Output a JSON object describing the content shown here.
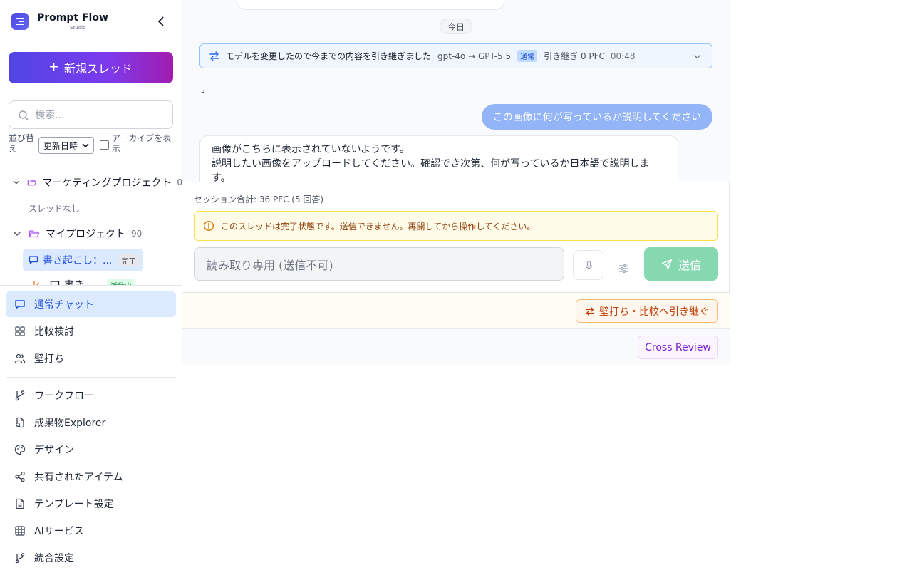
{
  "brand": {
    "title": "Prompt Flow",
    "subtitle": "Studio"
  },
  "sidebar": {
    "new_thread_label": "新規スレッド",
    "search_placeholder": "検索...",
    "sort_label": "並び替え",
    "sort_value": "更新日時",
    "archive_label": "アーカイブを表示",
    "projects": [
      {
        "name": "マーケティングプロジェクト",
        "count": "0",
        "empty_text": "スレッドなし"
      },
      {
        "name": "マイプロジェクト",
        "count": "90"
      }
    ],
    "threads": [
      {
        "title": "書き起こし：...",
        "badge": "完了"
      },
      {
        "title": "書き",
        "badge": "活動中"
      }
    ],
    "nav": [
      {
        "label": "通常チャット",
        "icon": "chat-bubble-icon"
      },
      {
        "label": "比較検討",
        "icon": "grid-icon"
      },
      {
        "label": "壁打ち",
        "icon": "users-icon"
      },
      {
        "label": "ワークフロー",
        "icon": "git-branch-icon"
      },
      {
        "label": "成果物Explorer",
        "icon": "file-search-icon"
      },
      {
        "label": "デザイン",
        "icon": "palette-icon"
      },
      {
        "label": "共有されたアイテム",
        "icon": "share-icon"
      },
      {
        "label": "テンプレート設定",
        "icon": "document-icon"
      },
      {
        "label": "AIサービス",
        "icon": "table-icon"
      },
      {
        "label": "統合設定",
        "icon": "git-branch-icon"
      }
    ]
  },
  "chat": {
    "day_label": "今日",
    "handoff": {
      "message": "モデルを変更したので今までの内容を引き継ぎました",
      "models": "gpt-4o → GPT-5.5",
      "tag": "通常",
      "cost": "引き継ぎ 0 PFC",
      "time": "00:48"
    },
    "corner_mark": "⌟",
    "user_message": "この画像に何が写っているか説明してください",
    "ai_message_lines": [
      "画像がこちらに表示されていないようです。",
      "説明したい画像をアップロードしてください。確認でき次第、何が写っているか日本語で説明しま",
      "す。"
    ]
  },
  "composer": {
    "session_total": "セッション合計: 36 PFC (5 回答)",
    "warning": "このスレッドは完了状態です。送信できません。再開してから操作してください。",
    "input_placeholder": "読み取り専用 (送信不可)",
    "send_label": "送信"
  },
  "footer": {
    "handoff_label": "壁打ち・比較へ引き継ぐ",
    "review_label": "Cross Review"
  },
  "colors": {
    "accent": "#4f46e5",
    "active_nav_bg": "#dbeafe",
    "send_disabled": "#86d8b0"
  }
}
